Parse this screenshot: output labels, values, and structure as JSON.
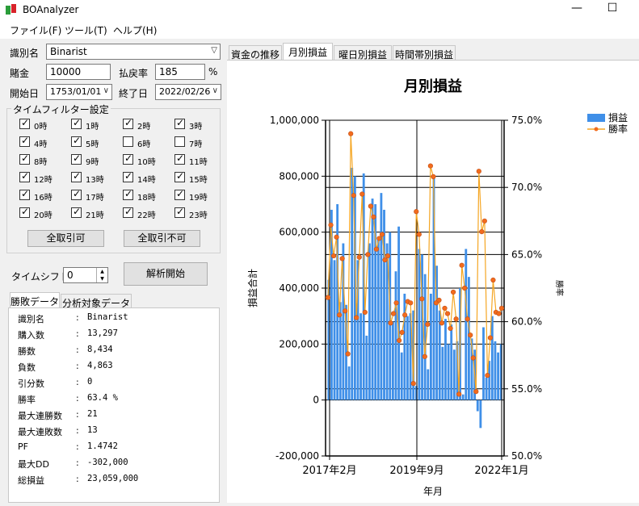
{
  "window": {
    "title": "BOAnalyzer",
    "minimize": "—",
    "maximize": "☐"
  },
  "menu": [
    "ファイル(F)",
    "ツール(T)",
    "ヘルプ(H)"
  ],
  "form": {
    "identifier_label": "識別名",
    "identifier_value": "Binarist",
    "stake_label": "賭金",
    "stake_value": "10000",
    "payout_label": "払戻率",
    "payout_value": "185",
    "payout_unit": "%",
    "start_label": "開始日",
    "start_value": "1753/01/01",
    "end_label": "終了日",
    "end_value": "2022/02/26"
  },
  "time_filter": {
    "title": "タイムフィルター設定",
    "hours": [
      {
        "label": "0時",
        "checked": true
      },
      {
        "label": "1時",
        "checked": true
      },
      {
        "label": "2時",
        "checked": true
      },
      {
        "label": "3時",
        "checked": true
      },
      {
        "label": "4時",
        "checked": true
      },
      {
        "label": "5時",
        "checked": true
      },
      {
        "label": "6時",
        "checked": false
      },
      {
        "label": "7時",
        "checked": false
      },
      {
        "label": "8時",
        "checked": true
      },
      {
        "label": "9時",
        "checked": true
      },
      {
        "label": "10時",
        "checked": true
      },
      {
        "label": "11時",
        "checked": true
      },
      {
        "label": "12時",
        "checked": true
      },
      {
        "label": "13時",
        "checked": true
      },
      {
        "label": "14時",
        "checked": true
      },
      {
        "label": "15時",
        "checked": true
      },
      {
        "label": "16時",
        "checked": true
      },
      {
        "label": "17時",
        "checked": true
      },
      {
        "label": "18時",
        "checked": true
      },
      {
        "label": "19時",
        "checked": true
      },
      {
        "label": "20時",
        "checked": true
      },
      {
        "label": "21時",
        "checked": true
      },
      {
        "label": "22時",
        "checked": true
      },
      {
        "label": "23時",
        "checked": true
      }
    ],
    "select_all": "全取引可",
    "deselect_all": "全取引不可"
  },
  "time_shift": {
    "label": "タイムシフト",
    "value": "0"
  },
  "analyze_button": "解析開始",
  "stats_tabs": [
    "勝敗データ",
    "分析対象データ"
  ],
  "stats": [
    {
      "key": "識別名",
      "value": "Binarist"
    },
    {
      "key": "購入数",
      "value": "13,297"
    },
    {
      "key": "勝数",
      "value": "8,434"
    },
    {
      "key": "負数",
      "value": "4,863"
    },
    {
      "key": "引分数",
      "value": "0"
    },
    {
      "key": "勝率",
      "value": "63.4 %"
    },
    {
      "key": "最大連勝数",
      "value": "21"
    },
    {
      "key": "最大連敗数",
      "value": "13"
    },
    {
      "key": "PF",
      "value": "1.4742"
    },
    {
      "key": "最大DD",
      "value": "-302,000"
    },
    {
      "key": "総損益",
      "value": "23,059,000"
    }
  ],
  "stats_colon": ":",
  "chart_tabs": [
    "資金の推移",
    "月別損益",
    "曜日別損益",
    "時間帯別損益"
  ],
  "colors": {
    "bar": "#3f8fe8",
    "line": "#f5a623",
    "marker": "#f26b1d"
  },
  "chart_data": {
    "type": "bar",
    "title": "月別損益",
    "xlabel": "年月",
    "ylabel": "損益合計",
    "y2label": "勝率",
    "ylim": [
      -200000,
      1000000
    ],
    "y2lim": [
      50.0,
      75.0
    ],
    "yticks": [
      "1,000,000",
      "800,000",
      "600,000",
      "400,000",
      "200,000",
      "0",
      "-200,000"
    ],
    "y2ticks": [
      "75.0%",
      "70.0%",
      "65.0%",
      "60.0%",
      "55.0%",
      "50.0%"
    ],
    "xticks": [
      "2017年2月",
      "2019年9月",
      "2022年1月"
    ],
    "legend_position": "top-right",
    "series": [
      {
        "name": "損益",
        "type": "bar",
        "values": [
          430000,
          680000,
          500000,
          700000,
          350000,
          560000,
          340000,
          120000,
          830000,
          800000,
          500000,
          310000,
          810000,
          230000,
          560000,
          720000,
          700000,
          580000,
          740000,
          680000,
          560000,
          600000,
          280000,
          460000,
          620000,
          170000,
          380000,
          300000,
          310000,
          320000,
          50000,
          540000,
          520000,
          450000,
          110000,
          380000,
          800000,
          480000,
          320000,
          190000,
          290000,
          200000,
          270000,
          180000,
          210000,
          400000,
          20000,
          540000,
          440000,
          220000,
          180000,
          -40000,
          -100000,
          260000,
          80000,
          140000,
          300000,
          210000,
          170000,
          200000
        ]
      },
      {
        "name": "勝率",
        "type": "line",
        "values": [
          61.8,
          67.2,
          64.9,
          66.3,
          60.5,
          64.7,
          60.8,
          57.6,
          74.0,
          69.4,
          60.3,
          64.8,
          69.5,
          60.7,
          65.0,
          68.6,
          67.8,
          65.4,
          66.2,
          66.5,
          64.6,
          64.9,
          59.9,
          60.6,
          61.4,
          58.6,
          59.2,
          60.5,
          61.5,
          61.4,
          55.4,
          68.2,
          66.5,
          61.7,
          57.4,
          59.8,
          71.6,
          70.8,
          61.4,
          61.6,
          59.9,
          61.0,
          60.6,
          59.5,
          62.2,
          60.2,
          54.6,
          64.2,
          62.5,
          60.2,
          59.0,
          57.3,
          54.8,
          71.2,
          66.7,
          67.5,
          56.0,
          58.8,
          63.1,
          60.7,
          60.6,
          61.0
        ]
      }
    ]
  }
}
